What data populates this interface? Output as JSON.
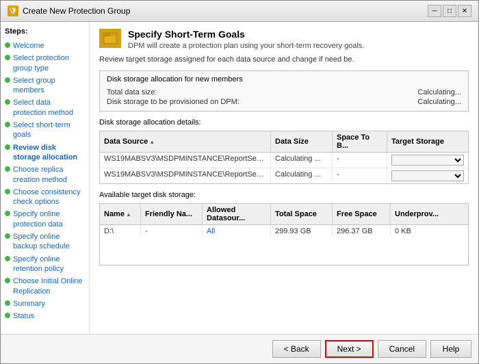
{
  "window": {
    "title": "Create New Protection Group",
    "icon": "folder-icon"
  },
  "header": {
    "title": "Specify Short-Term Goals",
    "subtitle": "DPM will create a protection plan using your short-term recovery goals."
  },
  "description": "Review target storage assigned for each data source and change if need be.",
  "sidebar": {
    "steps_label": "Steps:",
    "items": [
      {
        "label": "Welcome",
        "active": false,
        "dot": "green"
      },
      {
        "label": "Select protection group type",
        "active": false,
        "dot": "green"
      },
      {
        "label": "Select group members",
        "active": false,
        "dot": "green"
      },
      {
        "label": "Select data protection method",
        "active": false,
        "dot": "green"
      },
      {
        "label": "Select short-term goals",
        "active": false,
        "dot": "green"
      },
      {
        "label": "Review disk storage allocation",
        "active": true,
        "dot": "green"
      },
      {
        "label": "Choose replica creation method",
        "active": false,
        "dot": "green"
      },
      {
        "label": "Choose consistency check options",
        "active": false,
        "dot": "green"
      },
      {
        "label": "Specify online protection data",
        "active": false,
        "dot": "green"
      },
      {
        "label": "Specify online backup schedule",
        "active": false,
        "dot": "green"
      },
      {
        "label": "Specify online retention policy",
        "active": false,
        "dot": "green"
      },
      {
        "label": "Choose Initial Online Replication",
        "active": false,
        "dot": "green"
      },
      {
        "label": "Summary",
        "active": false,
        "dot": "green"
      },
      {
        "label": "Status",
        "active": false,
        "dot": "green"
      }
    ]
  },
  "disk_allocation": {
    "section_title": "Disk storage allocation for new members",
    "total_data_size_label": "Total data size:",
    "total_data_size_value": "Calculating...",
    "disk_provision_label": "Disk storage to be provisioned on DPM:",
    "disk_provision_value": "Calculating..."
  },
  "allocation_details": {
    "section_title": "Disk storage allocation details:",
    "columns": [
      {
        "label": "Data Source",
        "sort": true
      },
      {
        "label": "Data Size",
        "sort": false
      },
      {
        "label": "Space To B...",
        "sort": false
      },
      {
        "label": "Target Storage",
        "sort": false
      }
    ],
    "rows": [
      {
        "datasource": "WS19MABSV3\\MSDPMINSTANCE\\ReportServe...",
        "datasize": "Calculating ...",
        "spacetob": "-",
        "targetstorage": ""
      },
      {
        "datasource": "WS19MABSV3\\MSDPMINSTANCE\\ReportServe...",
        "datasize": "Calculating ...",
        "spacetob": "-",
        "targetstorage": ""
      }
    ]
  },
  "available_storage": {
    "section_title": "Available target disk storage:",
    "columns": [
      {
        "label": "Name",
        "sort": true
      },
      {
        "label": "Friendly Na...",
        "sort": false
      },
      {
        "label": "Allowed Datasour...",
        "sort": false
      },
      {
        "label": "Total Space",
        "sort": false
      },
      {
        "label": "Free Space",
        "sort": false
      },
      {
        "label": "Underprovï...",
        "sort": false
      }
    ],
    "rows": [
      {
        "name": "D:\\",
        "friendly": "-",
        "allowed": "All",
        "totalspace": "299.93 GB",
        "freespace": "296.37 GB",
        "underprov": "0 KB"
      }
    ]
  },
  "buttons": {
    "back": "< Back",
    "next": "Next >",
    "cancel": "Cancel",
    "help": "Help"
  }
}
